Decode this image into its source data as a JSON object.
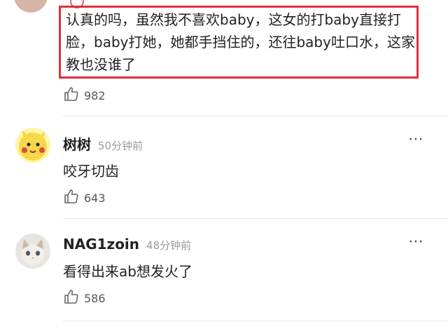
{
  "comments": [
    {
      "text": "认真的吗，虽然我不喜欢baby，这女的打baby直接打脸，baby打她，她都手挡住的，还往baby吐口水，这家教也没谁了",
      "likes": "982"
    },
    {
      "username": "树树",
      "time": "50分钟前",
      "text": "咬牙切齿",
      "likes": "643"
    },
    {
      "username": "NAG1zoin",
      "time": "48分钟前",
      "text": "看得出来ab想发火了",
      "likes": "586"
    }
  ],
  "icons": {
    "like": "thumbs-up-icon",
    "more": "more-dots-icon"
  },
  "colors": {
    "highlight_border": "#e0303c",
    "meta_text": "#9a9a9a"
  }
}
